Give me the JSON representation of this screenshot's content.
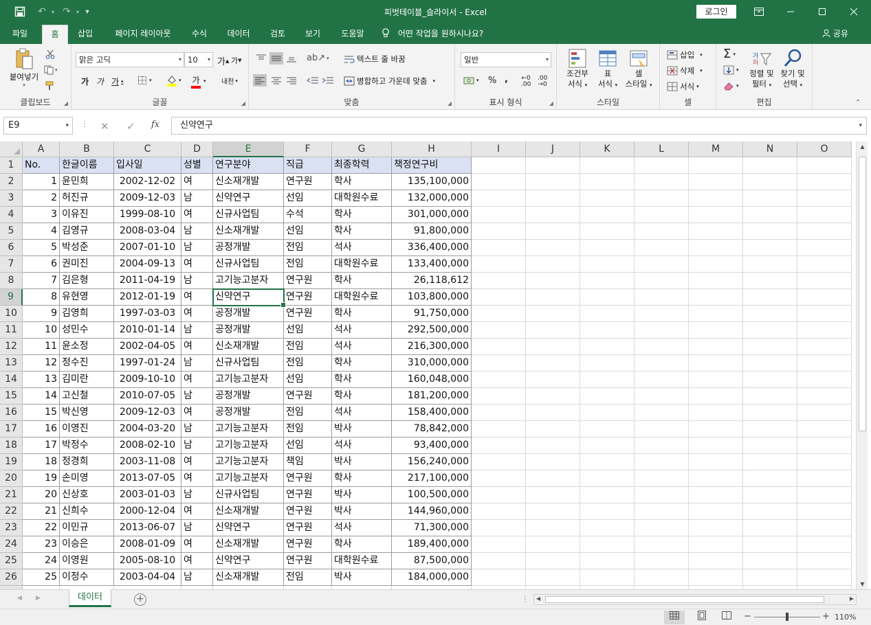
{
  "window": {
    "title": "피벗테이블_슬라이서  -  Excel",
    "login_label": "로그인"
  },
  "tabs": [
    {
      "label": "파일"
    },
    {
      "label": "홈"
    },
    {
      "label": "삽입"
    },
    {
      "label": "페이지 레이아웃"
    },
    {
      "label": "수식"
    },
    {
      "label": "데이터"
    },
    {
      "label": "검토"
    },
    {
      "label": "보기"
    },
    {
      "label": "도움말"
    }
  ],
  "active_tab": "홈",
  "tellme": "어떤 작업을 원하시나요?",
  "share": "공유",
  "ribbon": {
    "clipboard": {
      "label": "클립보드",
      "paste": "붙여넣기"
    },
    "font": {
      "label": "글꼴",
      "font_name": "맑은 고딕",
      "font_size": "10"
    },
    "alignment": {
      "label": "맞춤",
      "wrap_text": "텍스트 줄 바꿈",
      "merge_center": "병합하고 가운데 맞춤"
    },
    "number": {
      "label": "표시 형식",
      "format": "일반"
    },
    "styles": {
      "label": "스타일",
      "conditional_line1": "조건부",
      "conditional_line2": "서식",
      "table_line1": "표",
      "table_line2": "서식",
      "cell_line1": "셀",
      "cell_line2": "스타일"
    },
    "cells": {
      "label": "셀",
      "insert": "삽입",
      "delete": "삭제",
      "format": "서식"
    },
    "editing": {
      "label": "편집",
      "sort_line1": "정렬 및",
      "sort_line2": "필터",
      "find_line1": "찾기 및",
      "find_line2": "선택"
    }
  },
  "formula_bar": {
    "name_box": "E9",
    "fx": "fx",
    "formula": "신약연구"
  },
  "columns": [
    "A",
    "B",
    "C",
    "D",
    "E",
    "F",
    "G",
    "H",
    "I",
    "J",
    "K",
    "L",
    "M",
    "N",
    "O"
  ],
  "selected_cell": "E9",
  "header_row": [
    "No.",
    "한글이름",
    "입사일",
    "성별",
    "연구분야",
    "직급",
    "최종학력",
    "책정연구비"
  ],
  "rows": [
    [
      "1",
      "윤민희",
      "2002-12-02",
      "여",
      "신소재개발",
      "연구원",
      "학사",
      "135,100,000"
    ],
    [
      "2",
      "허진규",
      "2009-12-03",
      "남",
      "신약연구",
      "선임",
      "대학원수료",
      "132,000,000"
    ],
    [
      "3",
      "이유진",
      "1999-08-10",
      "여",
      "신규사업팀",
      "수석",
      "학사",
      "301,000,000"
    ],
    [
      "4",
      "김영규",
      "2008-03-04",
      "남",
      "신소재개발",
      "선임",
      "학사",
      "91,800,000"
    ],
    [
      "5",
      "박성준",
      "2007-01-10",
      "남",
      "공정개발",
      "전임",
      "석사",
      "336,400,000"
    ],
    [
      "6",
      "권미진",
      "2004-09-13",
      "여",
      "신규사업팀",
      "전임",
      "대학원수료",
      "133,400,000"
    ],
    [
      "7",
      "김은형",
      "2011-04-19",
      "남",
      "고기능고분자",
      "연구원",
      "학사",
      "26,118,612"
    ],
    [
      "8",
      "유현영",
      "2012-01-19",
      "여",
      "신약연구",
      "연구원",
      "대학원수료",
      "103,800,000"
    ],
    [
      "9",
      "김영희",
      "1997-03-03",
      "여",
      "공정개발",
      "연구원",
      "학사",
      "91,750,000"
    ],
    [
      "10",
      "성민수",
      "2010-01-14",
      "남",
      "공정개발",
      "선임",
      "석사",
      "292,500,000"
    ],
    [
      "11",
      "윤소정",
      "2002-04-05",
      "여",
      "신소재개발",
      "전임",
      "석사",
      "216,300,000"
    ],
    [
      "12",
      "정수진",
      "1997-01-24",
      "남",
      "신규사업팀",
      "전임",
      "학사",
      "310,000,000"
    ],
    [
      "13",
      "김미란",
      "2009-10-10",
      "여",
      "고기능고분자",
      "선임",
      "학사",
      "160,048,000"
    ],
    [
      "14",
      "고신철",
      "2010-07-05",
      "남",
      "공정개발",
      "연구원",
      "학사",
      "181,200,000"
    ],
    [
      "15",
      "박신영",
      "2009-12-03",
      "여",
      "공정개발",
      "전임",
      "석사",
      "158,400,000"
    ],
    [
      "16",
      "이영진",
      "2004-03-20",
      "남",
      "고기능고분자",
      "전임",
      "박사",
      "78,842,000"
    ],
    [
      "17",
      "박정수",
      "2008-02-10",
      "남",
      "고기능고분자",
      "선임",
      "석사",
      "93,400,000"
    ],
    [
      "18",
      "정경희",
      "2003-11-08",
      "여",
      "고기능고분자",
      "책임",
      "박사",
      "156,240,000"
    ],
    [
      "19",
      "손미영",
      "2013-07-05",
      "여",
      "고기능고분자",
      "연구원",
      "학사",
      "217,100,000"
    ],
    [
      "20",
      "신상호",
      "2003-01-03",
      "남",
      "신규사업팀",
      "연구원",
      "박사",
      "100,500,000"
    ],
    [
      "21",
      "신희수",
      "2000-12-04",
      "여",
      "신소재개발",
      "연구원",
      "박사",
      "144,960,000"
    ],
    [
      "22",
      "이민규",
      "2013-06-07",
      "남",
      "신약연구",
      "연구원",
      "석사",
      "71,300,000"
    ],
    [
      "23",
      "이승은",
      "2008-01-09",
      "여",
      "신소재개발",
      "연구원",
      "학사",
      "189,400,000"
    ],
    [
      "24",
      "이영원",
      "2005-08-10",
      "여",
      "신약연구",
      "연구원",
      "대학원수료",
      "87,500,000"
    ],
    [
      "25",
      "이정수",
      "2003-04-04",
      "남",
      "신소재개발",
      "전임",
      "박사",
      "184,000,000"
    ]
  ],
  "sheet_tab": "데이터",
  "status": {
    "zoom": "110%"
  }
}
